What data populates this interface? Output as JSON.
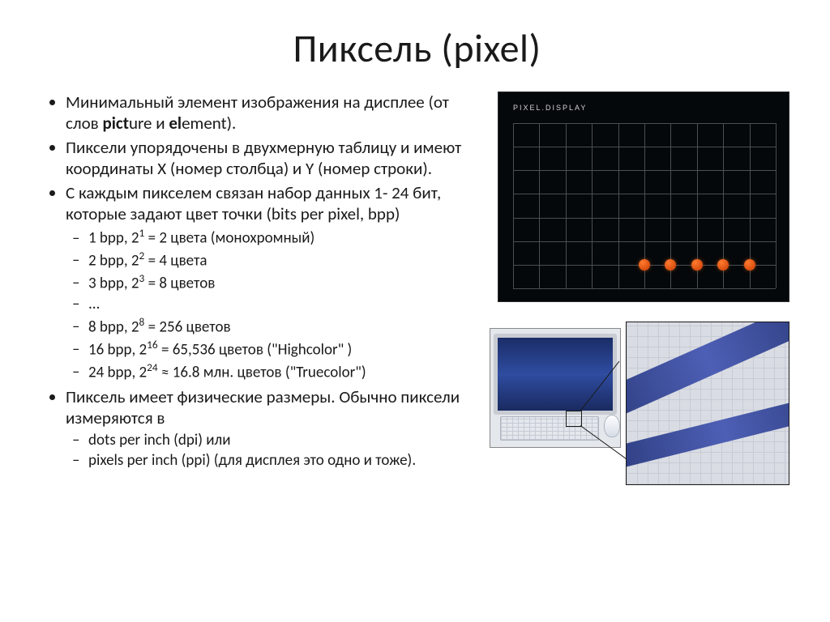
{
  "title": "Пиксель (pixel)",
  "bullets": {
    "b1_pre": "Минимальный элемент изображения на дисплее (от слов ",
    "b1_bold1": "pict",
    "b1_mid1": "ure и ",
    "b1_bold2": "el",
    "b1_mid2": "ement).",
    "b2": "Пиксели упорядочены в двухмерную таблицу и имеют координаты X (номер столбца) и Y (номер строки).",
    "b3": "С каждым пикселем связан набор данных 1- 24 бит, которые задают цвет точки (bits per pixel, bpp)",
    "b4": "Пиксель имеет физические размеры. Обычно пиксели измеряются в"
  },
  "bpp_list": {
    "i1a": "1 bpp, 2",
    "i1s": "1",
    "i1b": " = 2 цвета (монохромный)",
    "i2a": "2 bpp, 2",
    "i2s": "2",
    "i2b": " = 4 цвета",
    "i3a": "3 bpp, 2",
    "i3s": "3",
    "i3b": " = 8 цветов",
    "i4": "...",
    "i5a": "8 bpp, 2",
    "i5s": "8",
    "i5b": " = 256 цветов",
    "i6a": "16 bpp, 2",
    "i6s": "16",
    "i6b": " = 65,536 цветов (\"Highcolor\" )",
    "i7a": "24 bpp, 2",
    "i7s": "24",
    "i7b": " ≈ 16.8 млн. цветов (\"Truecolor\")"
  },
  "units_list": {
    "u1": "dots per inch (dpi) или",
    "u2": "pixels per inch (ppi)   (для дисплея это одно и тоже)."
  },
  "figure": {
    "grid_label": "PIXEL.DISPLAY"
  }
}
